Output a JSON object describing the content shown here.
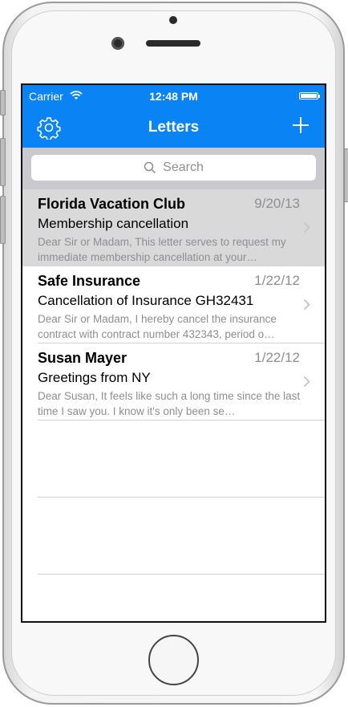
{
  "status_bar": {
    "carrier": "Carrier",
    "time": "12:48 PM"
  },
  "nav": {
    "title": "Letters",
    "left_icon": "gear-icon",
    "right_icon": "plus-icon"
  },
  "search": {
    "placeholder": "Search"
  },
  "letters": [
    {
      "sender": "Florida Vacation Club",
      "date": "9/20/13",
      "subject": "Membership cancellation",
      "preview": "Dear Sir or Madam,  This letter serves to request my immediate membership cancellation at your…",
      "selected": true
    },
    {
      "sender": "Safe Insurance",
      "date": "1/22/12",
      "subject": "Cancellation of Insurance GH32431",
      "preview": "Dear Sir or Madam,  I hereby cancel the insurance contract with contract number 432343, period o…",
      "selected": false
    },
    {
      "sender": "Susan Mayer",
      "date": "1/22/12",
      "subject": "Greetings from NY",
      "preview": "Dear Susan,  It feels like such a long time since the last time I saw you. I know it's only been se…",
      "selected": false
    }
  ],
  "colors": {
    "accent": "#0a84f5",
    "selected_row": "#d9d9d9",
    "search_bg": "#c9c9ce"
  }
}
